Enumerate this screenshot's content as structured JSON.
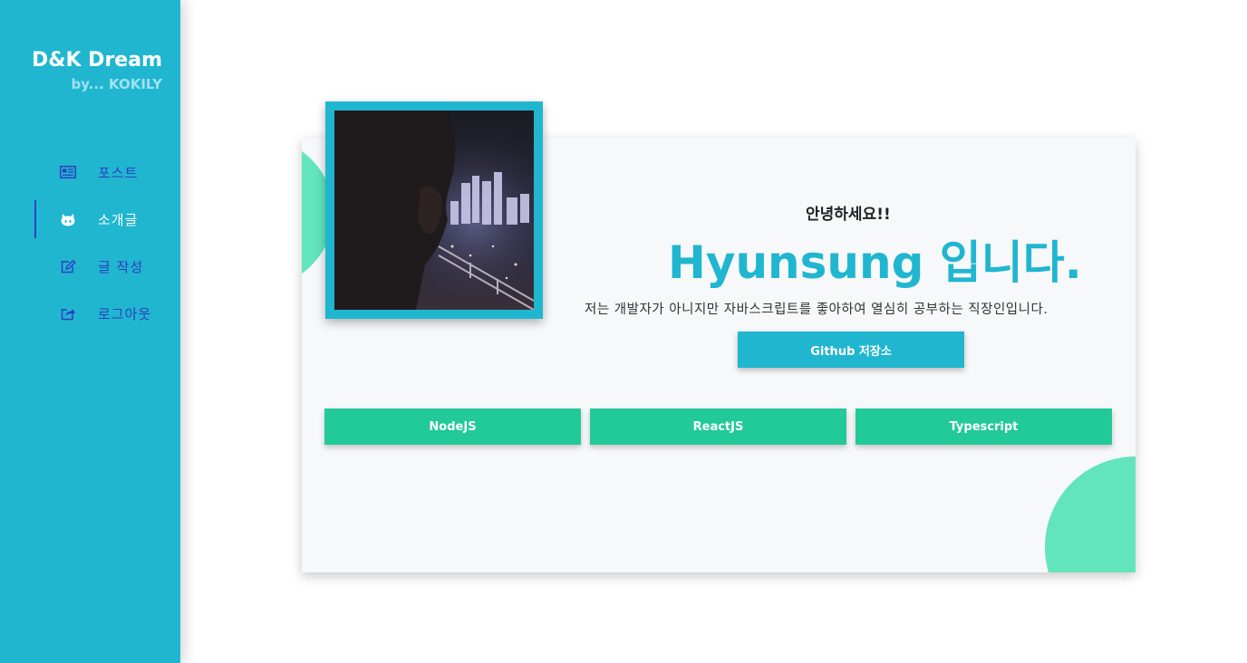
{
  "brand": {
    "title": "D&K Dream",
    "subtitle": "by... KOKILY"
  },
  "nav": {
    "items": [
      {
        "label": "포스트",
        "icon": "newspaper-icon"
      },
      {
        "label": "소개글",
        "icon": "github-cat-icon",
        "active": true
      },
      {
        "label": "글 작성",
        "icon": "edit-icon"
      },
      {
        "label": "로그아웃",
        "icon": "share-out-icon"
      }
    ]
  },
  "profile": {
    "greeting": "안녕하세요!!",
    "headline": "Hyunsung 입니다.",
    "intro": "저는 개발자가 아니지만 자바스크립트를 좋아하여 열심히 공부하는 직장인입니다.",
    "github_button": "Github 저장소"
  },
  "skills": [
    "NodeJS",
    "ReactJS",
    "Typescript"
  ],
  "colors": {
    "primary": "#20b6d0",
    "accent_green": "#21ca98",
    "blob_green": "#62e4bc",
    "nav_text": "#2d3fbf"
  }
}
